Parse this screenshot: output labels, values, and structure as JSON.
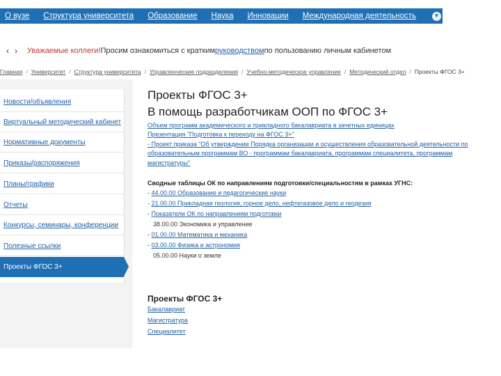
{
  "topnav": {
    "items": [
      "О вузе",
      "Структура университета",
      "Образование",
      "Наука",
      "Инновации",
      "Международная деятельность"
    ],
    "dropdown_icon": "chevron-down-icon"
  },
  "notice": {
    "prev": "‹",
    "next": "›",
    "red": "Уважаемые коллеги!",
    "text1": " Просим ознакомиться с кратким ",
    "link": "руководством",
    "text2": " по пользованию личным кабинетом"
  },
  "breadcrumbs": [
    "Главная",
    "Университет",
    "Структура университета",
    "Управленческие подразделения",
    "Учебно-методическое управление",
    "Методический отдел",
    "Проекты ФГОС 3+"
  ],
  "sidebar": {
    "items": [
      "Новости/объявления",
      "Виртуальный методический кабинет",
      "Нормативные документы",
      "Приказы/распоряжения",
      "Планы/графики",
      "Отчеты",
      "Конкурсы, семинары, конференции",
      "Полезные ссылки",
      "Проекты ФГОС 3+"
    ]
  },
  "main": {
    "title1": "Проекты ФГОС 3+",
    "title2": "В помощь разработчикам ООП по ФГОС 3+",
    "links1": [
      "Объем программ академического и прикладного бакалавриата в зачетных единицах",
      "Презентация \"Подготовка к переходу на ФГОС 3+\"",
      "- Проект приказа \"Об утверждении Порядка организации и осуществления образовательной деятельности по",
      "образовательным программам ВО - программам бакалавриата, программам специалитета, программам",
      "магистратуры\""
    ],
    "summary_title": "Сводные таблицы ОК по направлениям подготовки/специальностям в рамках УГНС:",
    "ugns": [
      {
        "prefix": "- ",
        "text": "44.00.00 Образование и педагогические науки",
        "link": true
      },
      {
        "prefix": "- ",
        "text": "21.00.00 Прикладная геология, горное дело, нефтегазовое дело и геодезия",
        "link": true
      },
      {
        "prefix": "- ",
        "text": "Показатели ОК по направлениям подготовки",
        "link": true
      },
      {
        "prefix": "  ",
        "text": "38.00.00 Экономика и управление",
        "link": false
      },
      {
        "prefix": "- ",
        "text": "01.00.00 Математика и механика",
        "link": true
      },
      {
        "prefix": "- ",
        "text": "03.00.00 Физика и астрономия",
        "link": true
      },
      {
        "prefix": "  ",
        "text": "05.00.00 Науки о земле",
        "link": false
      }
    ],
    "section2_title": "Проекты ФГОС 3+",
    "section2_links": [
      "Бакалавриат",
      "Магистратура",
      "Специалитет"
    ]
  }
}
